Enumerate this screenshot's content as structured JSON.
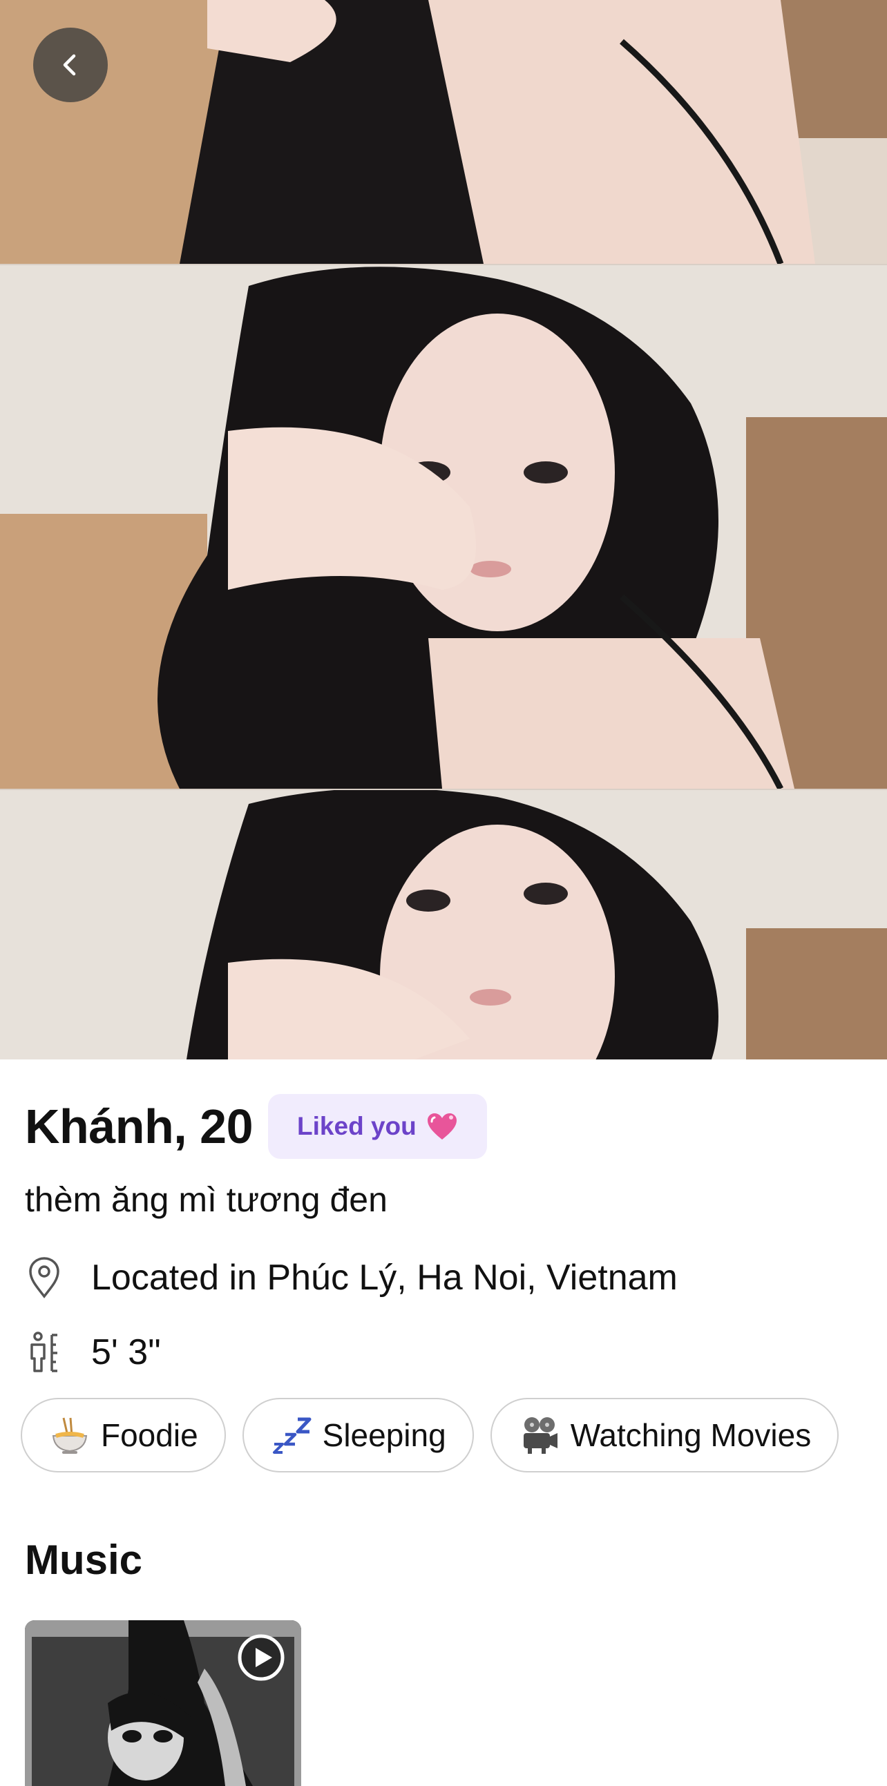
{
  "profile": {
    "name_age": "Khánh, 20",
    "liked_badge": "Liked you",
    "bio": "thèm ăng mì tương đen",
    "location": "Located in Phúc Lý, Ha Noi, Vietnam",
    "height": "5' 3\""
  },
  "interests": [
    {
      "label": "Foodie",
      "icon": "noodle-bowl-icon"
    },
    {
      "label": "Sleeping",
      "icon": "zzz-icon"
    },
    {
      "label": "Watching Movies",
      "icon": "film-projector-icon"
    }
  ],
  "music": {
    "section_title": "Music"
  },
  "icons": {
    "back": "back-arrow-icon",
    "liked": "heart-icon",
    "location": "location-pin-icon",
    "height": "height-person-icon",
    "play": "play-icon"
  },
  "colors": {
    "accent_purple": "#6c43c9",
    "badge_bg": "#f1ecfd",
    "chip_border": "#cfcfcf",
    "text": "#111111"
  }
}
